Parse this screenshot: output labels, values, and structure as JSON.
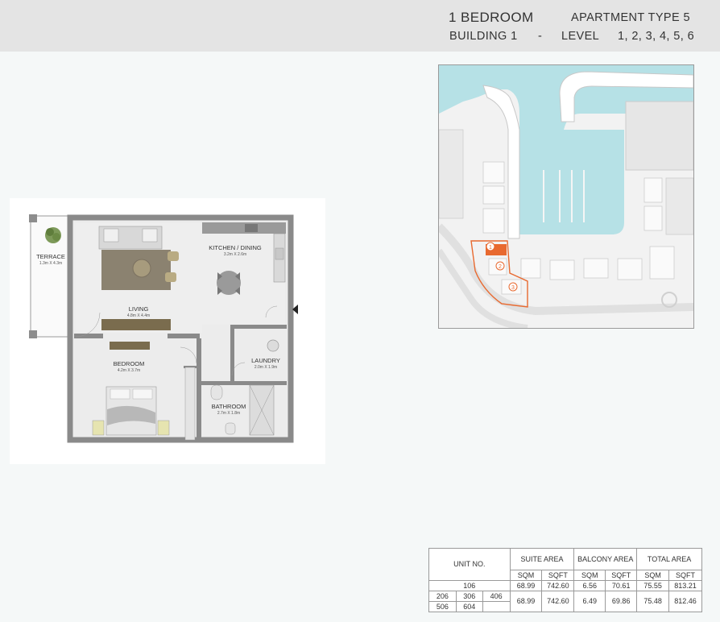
{
  "header": {
    "unit_type": "1 BEDROOM",
    "apartment_type": "APARTMENT  TYPE 5",
    "building": "BUILDING 1",
    "separator": "-",
    "level_label": "LEVEL",
    "levels": "1, 2, 3, 4, 5, 6"
  },
  "floor_plan": {
    "rooms": [
      {
        "name": "TERRACE",
        "dims": "1.3m X 4.3m"
      },
      {
        "name": "KITCHEN / DINING",
        "dims": "3.2m X 2.6m"
      },
      {
        "name": "LIVING",
        "dims": "4.8m X 4.4m"
      },
      {
        "name": "LAUNDRY",
        "dims": "2.0m X 1.9m"
      },
      {
        "name": "BEDROOM",
        "dims": "4.2m X 3.7m"
      },
      {
        "name": "BATHROOM",
        "dims": "2.7m X 1.8m"
      }
    ]
  },
  "site_map": {
    "markers": [
      "1",
      "2",
      "3"
    ],
    "colors": {
      "water": "#b6e1e6",
      "highlight": "#e8692f",
      "land": "#f2f2f2"
    }
  },
  "table": {
    "headers": {
      "unit_no": "UNIT NO.",
      "suite_area": "SUITE AREA",
      "balcony_area": "BALCONY AREA",
      "total_area": "TOTAL AREA",
      "sqm": "SQM",
      "sqft": "SQFT"
    },
    "rows": [
      {
        "units": [
          "106"
        ],
        "suite_sqm": "68.99",
        "suite_sqft": "742.60",
        "balcony_sqm": "6.56",
        "balcony_sqft": "70.61",
        "total_sqm": "75.55",
        "total_sqft": "813.21"
      },
      {
        "units": [
          "206",
          "306",
          "406",
          "506",
          "604"
        ],
        "suite_sqm": "68.99",
        "suite_sqft": "742.60",
        "balcony_sqm": "6.49",
        "balcony_sqft": "69.86",
        "total_sqm": "75.48",
        "total_sqft": "812.46"
      }
    ]
  }
}
